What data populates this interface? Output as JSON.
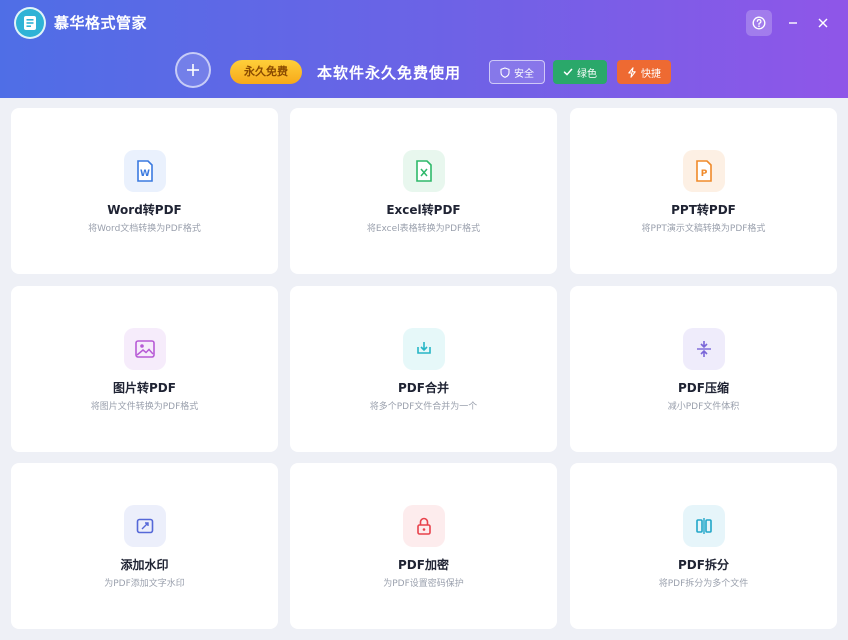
{
  "app": {
    "title": "慕华格式管家"
  },
  "banner": {
    "free_badge": "永久免费",
    "slogan": "本软件永久免费使用",
    "tags": [
      {
        "label": "安全",
        "icon": "shield-icon"
      },
      {
        "label": "绿色",
        "icon": "check-icon",
        "color": "#2aa86a"
      },
      {
        "label": "快捷",
        "icon": "lightning-icon",
        "color": "#ee6a32"
      }
    ]
  },
  "cards": [
    {
      "title": "Word转PDF",
      "desc": "将Word文档转换为PDF格式",
      "icon": "word-file-icon",
      "color": "#3b7ae0"
    },
    {
      "title": "Excel转PDF",
      "desc": "将Excel表格转换为PDF格式",
      "icon": "excel-file-icon",
      "color": "#2fb96a"
    },
    {
      "title": "PPT转PDF",
      "desc": "将PPT演示文稿转换为PDF格式",
      "icon": "ppt-file-icon",
      "color": "#f08a2a"
    },
    {
      "title": "图片转PDF",
      "desc": "将图片文件转换为PDF格式",
      "icon": "image-icon",
      "color": "#b75bd6"
    },
    {
      "title": "PDF合并",
      "desc": "将多个PDF文件合并为一个",
      "icon": "merge-icon",
      "color": "#26b6c6"
    },
    {
      "title": "PDF压缩",
      "desc": "减小PDF文件体积",
      "icon": "compress-icon",
      "color": "#7a66d8"
    },
    {
      "title": "添加水印",
      "desc": "为PDF添加文字水印",
      "icon": "watermark-icon",
      "color": "#5568d8"
    },
    {
      "title": "PDF加密",
      "desc": "为PDF设置密码保护",
      "icon": "lock-icon",
      "color": "#e8414b"
    },
    {
      "title": "PDF拆分",
      "desc": "将PDF拆分为多个文件",
      "icon": "split-icon",
      "color": "#22a7c9"
    }
  ]
}
